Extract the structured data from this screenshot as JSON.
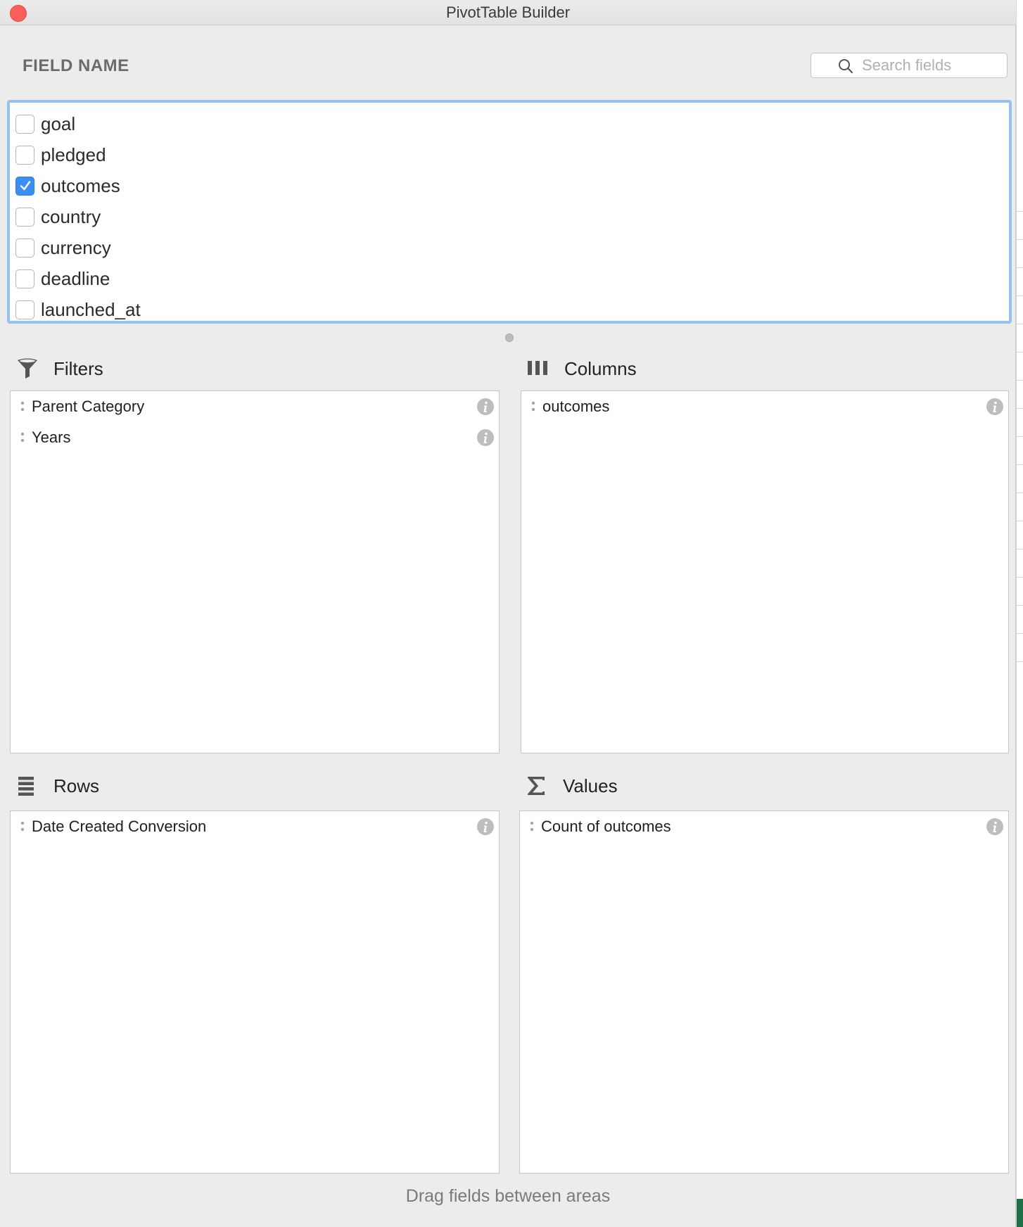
{
  "window": {
    "title": "PivotTable Builder"
  },
  "field_panel": {
    "header": "FIELD NAME",
    "search_placeholder": "Search fields",
    "fields": [
      {
        "label": "goal",
        "checked": false
      },
      {
        "label": "pledged",
        "checked": false
      },
      {
        "label": "outcomes",
        "checked": true
      },
      {
        "label": "country",
        "checked": false
      },
      {
        "label": "currency",
        "checked": false
      },
      {
        "label": "deadline",
        "checked": false
      },
      {
        "label": "launched_at",
        "checked": false
      }
    ]
  },
  "areas": {
    "filters": {
      "label": "Filters",
      "icon": "filter-icon",
      "items": [
        "Parent Category",
        "Years"
      ]
    },
    "columns": {
      "label": "Columns",
      "icon": "columns-icon",
      "items": [
        "outcomes"
      ]
    },
    "rows": {
      "label": "Rows",
      "icon": "rows-icon",
      "items": [
        "Date Created Conversion"
      ]
    },
    "values": {
      "label": "Values",
      "icon": "sigma-icon",
      "items": [
        "Count of outcomes"
      ]
    }
  },
  "footer": {
    "hint": "Drag fields between areas"
  },
  "colors": {
    "accent": "#3b8ef3",
    "focus_ring": "#96c1ef",
    "close": "#fc5f57"
  }
}
